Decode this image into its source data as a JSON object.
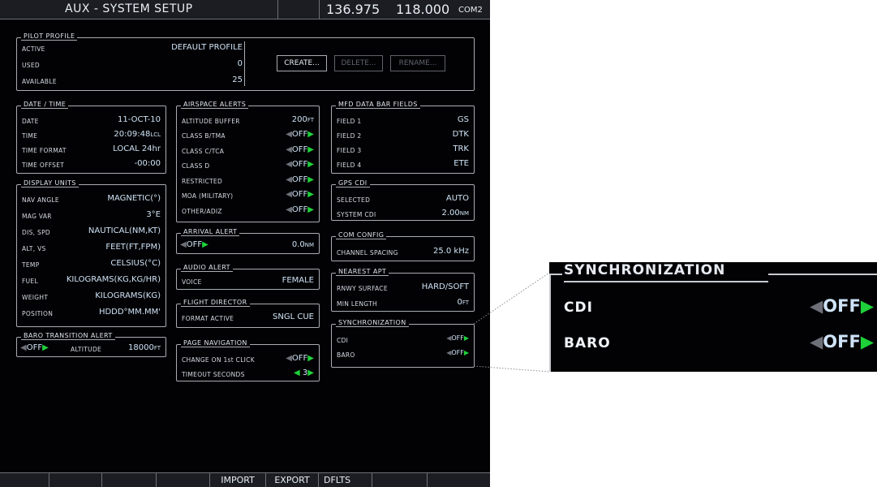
{
  "header": {
    "title": "AUX - SYSTEM SETUP",
    "active_freq": "136.975",
    "standby_freq": "118.000",
    "com": "COM2"
  },
  "pilot_profile": {
    "title": "PILOT PROFILE",
    "active_label": "ACTIVE",
    "active_value": "DEFAULT PROFILE",
    "used_label": "USED",
    "used_value": "0",
    "available_label": "AVAILABLE",
    "available_value": "25",
    "create": "CREATE...",
    "delete": "DELETE...",
    "rename": "RENAME..."
  },
  "date_time": {
    "title": "DATE / TIME",
    "date_label": "DATE",
    "date_value": "11-OCT-10",
    "time_label": "TIME",
    "time_value": "20:09:48",
    "time_unit": "LCL",
    "format_label": "TIME FORMAT",
    "format_value": "LOCAL 24hr",
    "offset_label": "TIME OFFSET",
    "offset_value": "-00:00"
  },
  "display_units": {
    "title": "DISPLAY UNITS",
    "rows": [
      {
        "label": "NAV ANGLE",
        "value": "MAGNETIC(°)"
      },
      {
        "label": "MAG VAR",
        "value": "3°E"
      },
      {
        "label": "DIS, SPD",
        "value": "NAUTICAL(NM,KT)"
      },
      {
        "label": "ALT, VS",
        "value": "FEET(FT,FPM)"
      },
      {
        "label": "TEMP",
        "value": "CELSIUS(°C)"
      },
      {
        "label": "FUEL",
        "value": "KILOGRAMS(KG,KG/HR)"
      },
      {
        "label": "WEIGHT",
        "value": "KILOGRAMS(KG)"
      },
      {
        "label": "POSITION",
        "value": "HDDD°MM.MM'"
      }
    ]
  },
  "baro_transition": {
    "title": "BARO TRANSITION ALERT",
    "state": "OFF",
    "altitude_label": "ALTITUDE",
    "altitude_value": "18000",
    "altitude_unit": "FT"
  },
  "airspace_alerts": {
    "title": "AIRSPACE ALERTS",
    "buffer_label": "ALTITUDE BUFFER",
    "buffer_value": "200",
    "buffer_unit": "FT",
    "rows": [
      {
        "label": "CLASS B/TMA",
        "value": "OFF"
      },
      {
        "label": "CLASS C/TCA",
        "value": "OFF"
      },
      {
        "label": "CLASS D",
        "value": "OFF"
      },
      {
        "label": "RESTRICTED",
        "value": "OFF"
      },
      {
        "label": "MOA (MILITARY)",
        "value": "OFF"
      },
      {
        "label": "OTHER/ADIZ",
        "value": "OFF"
      }
    ]
  },
  "arrival_alert": {
    "title": "ARRIVAL ALERT",
    "state": "OFF",
    "value": "0.0",
    "unit": "NM"
  },
  "audio_alert": {
    "title": "AUDIO ALERT",
    "voice_label": "VOICE",
    "voice_value": "FEMALE"
  },
  "flight_director": {
    "title": "FLIGHT DIRECTOR",
    "format_label": "FORMAT ACTIVE",
    "format_value": "SNGL CUE"
  },
  "page_navigation": {
    "title": "PAGE NAVIGATION",
    "change_label": "CHANGE ON 1st CLICK",
    "change_value": "OFF",
    "timeout_label": "TIMEOUT SECONDS",
    "timeout_value": "3"
  },
  "mfd_fields": {
    "title": "MFD DATA BAR FIELDS",
    "rows": [
      {
        "label": "FIELD 1",
        "value": "GS"
      },
      {
        "label": "FIELD 2",
        "value": "DTK"
      },
      {
        "label": "FIELD 3",
        "value": "TRK"
      },
      {
        "label": "FIELD 4",
        "value": "ETE"
      }
    ]
  },
  "gps_cdi": {
    "title": "GPS CDI",
    "selected_label": "SELECTED",
    "selected_value": "AUTO",
    "system_label": "SYSTEM CDI",
    "system_value": "2.00",
    "system_unit": "NM"
  },
  "com_config": {
    "title": "COM CONFIG",
    "spacing_label": "CHANNEL SPACING",
    "spacing_value": "25.0 kHz"
  },
  "nearest_apt": {
    "title": "NEAREST APT",
    "rnwy_label": "RNWY SURFACE",
    "rnwy_value": "HARD/SOFT",
    "min_label": "MIN LENGTH",
    "min_value": "0",
    "min_unit": "FT"
  },
  "synchronization": {
    "title": "SYNCHRONIZATION",
    "cdi_label": "CDI",
    "cdi_value": "OFF",
    "baro_label": "BARO",
    "baro_value": "OFF"
  },
  "softkeys": {
    "import": "IMPORT",
    "export": "EXPORT",
    "dflts": "DFLTS"
  },
  "zoom": {
    "title": "SYNCHRONIZATION",
    "cdi_label": "CDI",
    "cdi_value": "OFF",
    "baro_label": "BARO",
    "baro_value": "OFF"
  },
  "colors": {
    "background": "#020204",
    "value_cyan": "#cfe3f7",
    "arrow_green": "#1ed13a",
    "arrow_gray": "#6d7078"
  },
  "icons": {
    "left_arrow": "left-arrow-icon",
    "right_arrow": "right-arrow-icon"
  }
}
